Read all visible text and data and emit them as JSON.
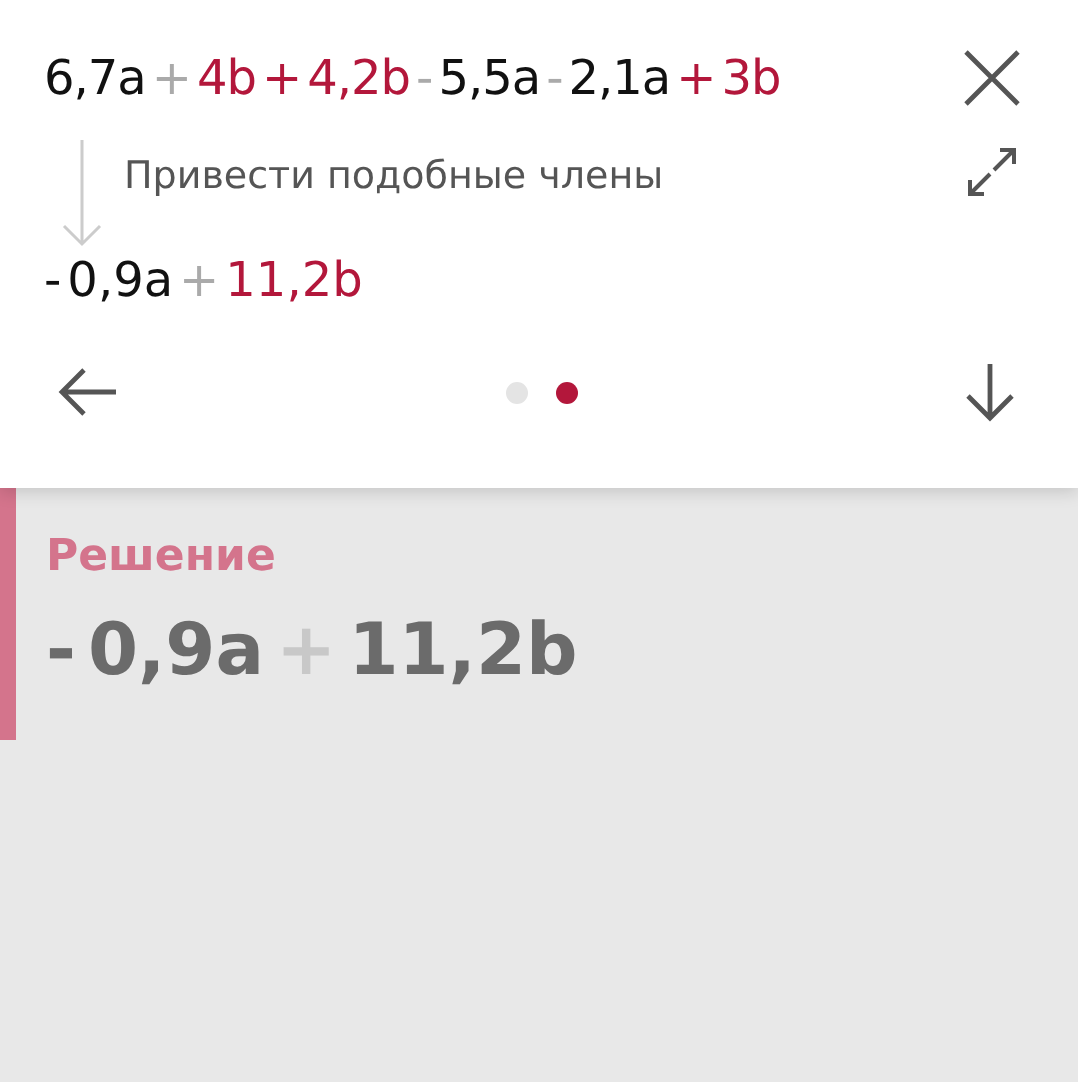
{
  "step": {
    "expression": [
      {
        "text": "6,7a",
        "color": "#111111"
      },
      {
        "text": "+",
        "color": "#aaaaaa"
      },
      {
        "text": "4b",
        "color": "#b3173b"
      },
      {
        "text": "+",
        "color": "#b3173b"
      },
      {
        "text": "4,2b",
        "color": "#b3173b"
      },
      {
        "text": "-",
        "color": "#aaaaaa"
      },
      {
        "text": "5,5a",
        "color": "#111111"
      },
      {
        "text": "-",
        "color": "#aaaaaa"
      },
      {
        "text": "2,1a",
        "color": "#111111"
      },
      {
        "text": "+",
        "color": "#b3173b"
      },
      {
        "text": "3b",
        "color": "#b3173b"
      }
    ],
    "instruction": "Привести подобные члены",
    "result": [
      {
        "text": "-",
        "color": "#111111"
      },
      {
        "text": "0,9a",
        "color": "#111111"
      },
      {
        "text": "+",
        "color": "#aaaaaa"
      },
      {
        "text": "11,2b",
        "color": "#b3173b"
      }
    ],
    "pages": [
      {
        "selected": false
      },
      {
        "selected": true
      }
    ]
  },
  "solution": {
    "title": "Решение",
    "expression": [
      {
        "text": "-",
        "color": "#6b6b6b"
      },
      {
        "text": "0,9a",
        "color": "#6b6b6b"
      },
      {
        "text": "+",
        "color": "#c8c8c8"
      },
      {
        "text": "11,2b",
        "color": "#6b6b6b"
      }
    ]
  }
}
